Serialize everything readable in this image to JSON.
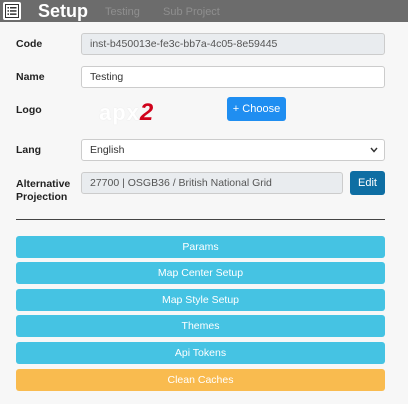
{
  "window": {
    "title": "Setup",
    "ghost_tabs": [
      "Testing",
      "Sub Project"
    ]
  },
  "form": {
    "code": {
      "label": "Code",
      "value": "inst-b450013e-fe3c-bb7a-4c05-8e59445"
    },
    "name": {
      "label": "Name",
      "value": "Testing"
    },
    "logo": {
      "label": "Logo",
      "choose_label": "+ Choose",
      "logo_text_main": "apx",
      "logo_text_accent": "2"
    },
    "lang": {
      "label": "Lang",
      "selected": "English"
    },
    "projection": {
      "label_line1": "Alternative",
      "label_line2": "Projection",
      "value": "27700 | OSGB36 / British National Grid",
      "edit_label": "Edit"
    }
  },
  "actions": [
    {
      "label": "Params"
    },
    {
      "label": "Map Center Setup"
    },
    {
      "label": "Map Style Setup"
    },
    {
      "label": "Themes"
    },
    {
      "label": "Api Tokens"
    },
    {
      "label": "Clean Caches"
    }
  ],
  "colors": {
    "primary": "#1f8ef1",
    "info": "#45c3e3",
    "warning": "#f9bb4f",
    "edit": "#0e6ea3",
    "logo_accent": "#d0021b"
  }
}
